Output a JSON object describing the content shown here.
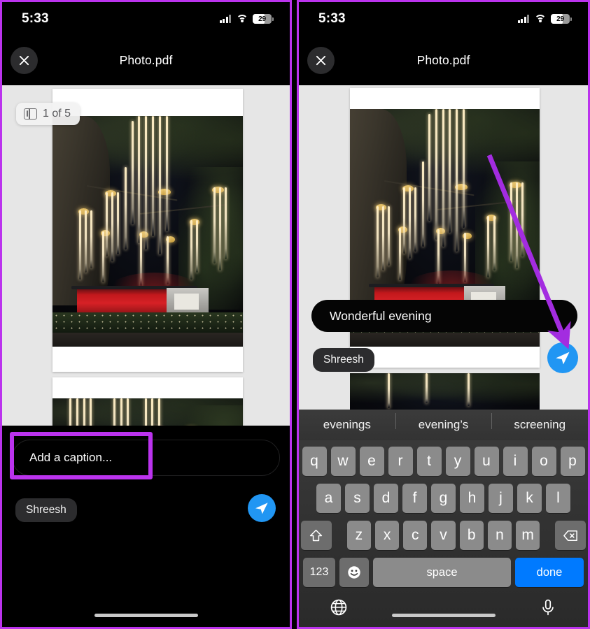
{
  "status_bar": {
    "time": "5:33",
    "battery_level": "29",
    "signal_icon": "signal-bars-icon",
    "wifi_icon": "wifi-icon",
    "battery_icon": "battery-icon"
  },
  "header": {
    "title": "Photo.pdf",
    "close_icon": "close-x-icon"
  },
  "left_panel": {
    "page_indicator": {
      "label": "1 of 5",
      "icon": "page-thumbnails-icon"
    },
    "caption_field": {
      "placeholder": "Add a caption...",
      "value": ""
    },
    "recipient_chip": "Shreesh",
    "send_icon": "send-paper-plane-icon",
    "highlight_color": "#bb33ee"
  },
  "right_panel": {
    "caption_field": {
      "value": "Wonderful evening"
    },
    "recipient_chip": "Shreesh",
    "send_icon": "send-paper-plane-icon",
    "annotation_arrow": {
      "icon": "arrow-pointer-icon",
      "color": "#a32ce0",
      "points_to": "send-button"
    },
    "keyboard": {
      "suggestions": [
        "evenings",
        "evening’s",
        "screening"
      ],
      "row1": [
        "q",
        "w",
        "e",
        "r",
        "t",
        "y",
        "u",
        "i",
        "o",
        "p"
      ],
      "row2": [
        "a",
        "s",
        "d",
        "f",
        "g",
        "h",
        "j",
        "k",
        "l"
      ],
      "row3_shift_icon": "shift-arrow-icon",
      "row3": [
        "z",
        "x",
        "c",
        "v",
        "b",
        "n",
        "m"
      ],
      "row3_backspace_icon": "backspace-icon",
      "numbers_key": "123",
      "emoji_key_icon": "emoji-smiley-icon",
      "space_key": "space",
      "done_key": "done",
      "globe_icon": "globe-language-icon",
      "mic_icon": "microphone-icon",
      "done_key_color": "#007aff"
    }
  },
  "theme": {
    "accent_send": "#2196f3",
    "highlight": "#bb33ee",
    "doc_background": "#e6e6e6",
    "panel_background": "#000000"
  }
}
